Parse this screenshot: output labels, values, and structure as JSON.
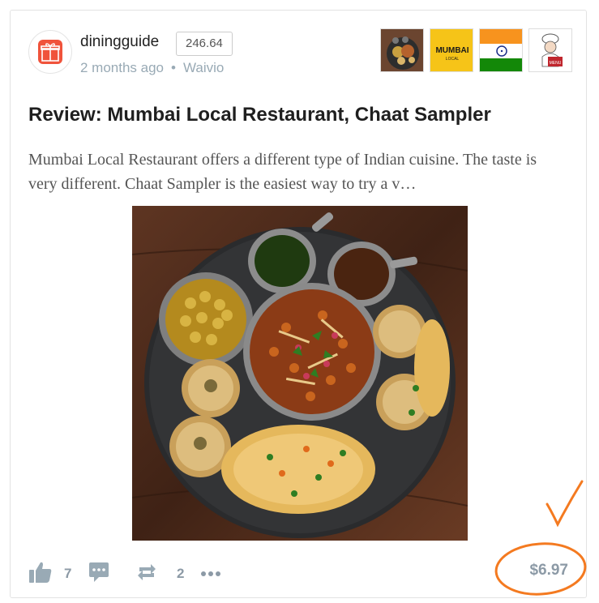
{
  "post": {
    "author": "diningguide",
    "author_score": "246.64",
    "time_ago": "2 months ago",
    "app": "Waivio",
    "title": "Review: Mumbai Local Restaurant, Chaat Sampler",
    "excerpt": "Mumbai Local Restaurant offers a different type of Indian cuisine. The taste is very different. Chaat Sampler is the easiest way to try a v…",
    "thumbnails": [
      {
        "name": "food-photo-thumbnail"
      },
      {
        "name": "mumbai-local-logo-thumbnail",
        "logo_text": "MUMBAI",
        "logo_subtext": "LOCAL"
      },
      {
        "name": "india-flag-thumbnail"
      },
      {
        "name": "chef-menu-thumbnail",
        "logo_text": "MENU"
      }
    ]
  },
  "actions": {
    "likes": "7",
    "reblogs": "2",
    "payout": "$6.97",
    "icons": [
      "thumbs-up-icon",
      "comment-icon",
      "reblog-icon",
      "more-icon"
    ]
  },
  "colors": {
    "accent_orange": "#f47a20",
    "muted_text": "#99aab5",
    "avatar_red": "#f0533b"
  }
}
